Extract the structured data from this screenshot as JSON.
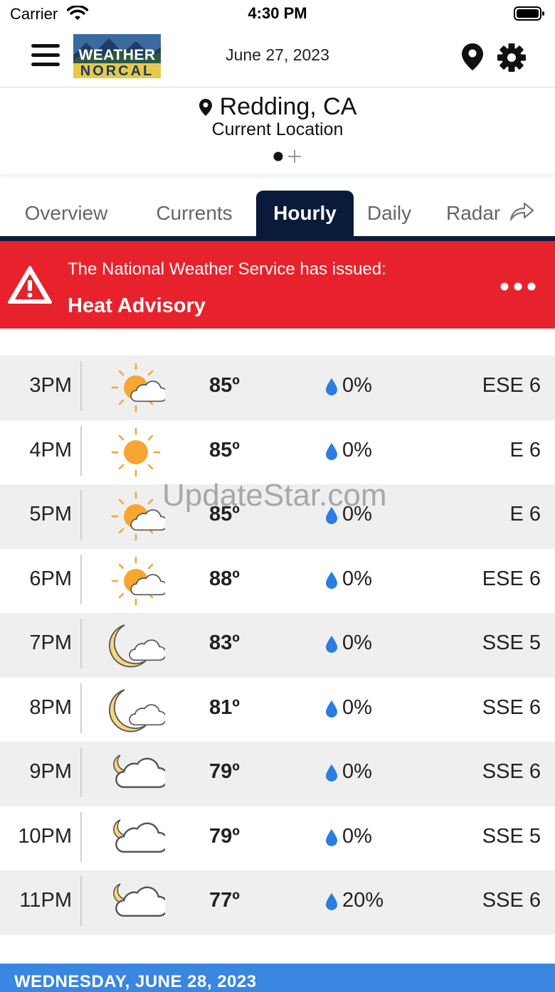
{
  "status_bar": {
    "carrier": "Carrier",
    "time": "4:30 PM"
  },
  "header": {
    "logo_line1": "WEATHER",
    "logo_line2": "NORCAL",
    "date": "June 27, 2023"
  },
  "location": {
    "city": "Redding, CA",
    "subtitle": "Current Location"
  },
  "tabs": [
    {
      "label": "Overview",
      "active": false
    },
    {
      "label": "Currents",
      "active": false
    },
    {
      "label": "Hourly",
      "active": true
    },
    {
      "label": "Daily",
      "active": false
    },
    {
      "label": "Radar",
      "active": false
    }
  ],
  "alert": {
    "line1": "The National Weather Service has issued:",
    "line2": "Heat Advisory"
  },
  "hourly": [
    {
      "time": "3PM",
      "icon": "sun-cloud-icon",
      "temp": "85º",
      "precip": "0%",
      "wind": "ESE 6"
    },
    {
      "time": "4PM",
      "icon": "sun-icon",
      "temp": "85º",
      "precip": "0%",
      "wind": "E 6"
    },
    {
      "time": "5PM",
      "icon": "sun-cloud-icon",
      "temp": "85º",
      "precip": "0%",
      "wind": "E 6"
    },
    {
      "time": "6PM",
      "icon": "sun-cloud-icon",
      "temp": "88º",
      "precip": "0%",
      "wind": "ESE 6"
    },
    {
      "time": "7PM",
      "icon": "moon-cloud-icon",
      "temp": "83º",
      "precip": "0%",
      "wind": "SSE 5"
    },
    {
      "time": "8PM",
      "icon": "moon-cloud-icon",
      "temp": "81º",
      "precip": "0%",
      "wind": "SSE 6"
    },
    {
      "time": "9PM",
      "icon": "cloud-moon-icon",
      "temp": "79º",
      "precip": "0%",
      "wind": "SSE 6"
    },
    {
      "time": "10PM",
      "icon": "cloud-moon-icon",
      "temp": "79º",
      "precip": "0%",
      "wind": "SSE 5"
    },
    {
      "time": "11PM",
      "icon": "cloud-moon-icon",
      "temp": "77º",
      "precip": "20%",
      "wind": "SSE 6"
    }
  ],
  "day_header": "WEDNESDAY, JUNE 28, 2023",
  "watermark": "UpdateStar.com",
  "colors": {
    "navy": "#0a1a3a",
    "alert": "#e8222c",
    "day_bar": "#3a86e0",
    "drop": "#2a7de1",
    "sun": "#f7a632"
  }
}
